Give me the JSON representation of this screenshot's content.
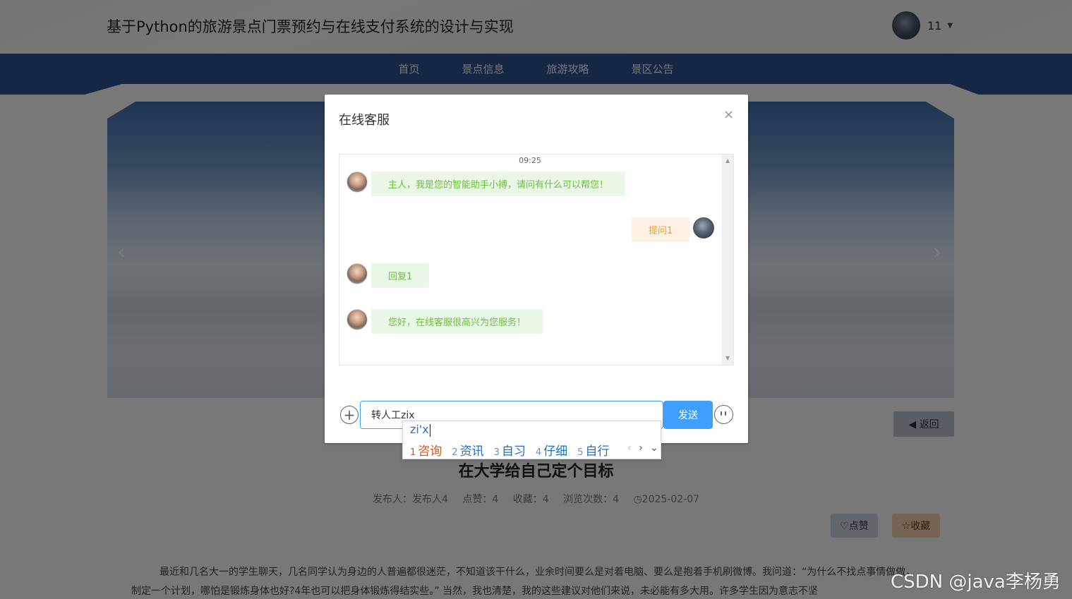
{
  "header": {
    "title": "基于Python的旅游景点门票预约与在线支付系统的设计与实现",
    "user_name": "11",
    "caret": "▼"
  },
  "nav": {
    "items": [
      {
        "label": "首页"
      },
      {
        "label": "景点信息"
      },
      {
        "label": "旅游攻略"
      },
      {
        "label": "景区公告"
      }
    ]
  },
  "banner": {
    "prev": "‹",
    "next": "›"
  },
  "page": {
    "back_label": "◀ 返回",
    "article_title": "在大学给自己定个目标",
    "meta": {
      "publisher": "发布人：发布人4",
      "likes": "点赞：4",
      "favorites": "收藏：4",
      "views": "浏览次数：4",
      "date": "◷2025-02-07"
    },
    "like_label": "♡点赞",
    "fav_label": "☆收藏",
    "body": "最近和几名大一的学生聊天，几名同学认为身边的人普遍都很迷茫，不知道该干什么，业余时间要么是对着电脑、要么是抱着手机刷微博。我问道：“为什么不找点事情做做，制定一个计划，哪怕是锻炼身体也好?4年也可以把身体锻炼得结实些。” 当然，我也清楚，我的这些建议对他们来说，未必能有多大用。许多学生因为意志不坚"
  },
  "dialog": {
    "title": "在线客服",
    "close": "×",
    "time": "09:25",
    "messages": [
      {
        "from": "bot",
        "text": "主人，我是您的智能助手小搏，请问有什么可以帮您！"
      },
      {
        "from": "me",
        "text": "提问1"
      },
      {
        "from": "bot",
        "text": "回复1"
      },
      {
        "from": "bot",
        "text": "您好，在线客服很高兴为您服务！"
      }
    ],
    "input_value": "转人工zix",
    "send_label": "发送",
    "plus": "+",
    "scroll_up": "▲",
    "scroll_down": "▼"
  },
  "ime": {
    "composition": "zi'x",
    "candidates": [
      {
        "num": "1",
        "text": "咨询"
      },
      {
        "num": "2",
        "text": "资讯"
      },
      {
        "num": "3",
        "text": "自习"
      },
      {
        "num": "4",
        "text": "仔细"
      },
      {
        "num": "5",
        "text": "自行"
      }
    ],
    "prev": "‹",
    "next": "›",
    "expand": "⌄"
  },
  "watermark": "CSDN @java李杨勇",
  "colors": {
    "primary": "#409eff",
    "nav_bg": "#2b4f86",
    "bot_bubble_bg": "#eaf6e6",
    "bot_text": "#67c23a",
    "me_bubble_bg": "#fdf1e4",
    "me_text": "#e6a23c"
  }
}
